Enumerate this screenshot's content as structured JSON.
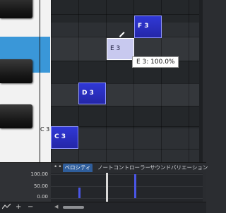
{
  "piano": {
    "labels": {
      "c3": "C 3"
    }
  },
  "notes": [
    {
      "id": "f3",
      "label": "F 3",
      "selected": false
    },
    {
      "id": "e3",
      "label": "E 3",
      "selected": true
    },
    {
      "id": "d3",
      "label": "D 3",
      "selected": false
    },
    {
      "id": "c3",
      "label": "C 3",
      "selected": false
    }
  ],
  "tooltip": {
    "text": "E 3: 100.0%"
  },
  "lower_editor": {
    "menu_dots": "•••",
    "tabs": [
      "ベロシティ",
      "ノートコントローラー",
      "サウンドバリエーション"
    ],
    "active_tab": 0,
    "axis_labels": [
      "100.00",
      "50.00",
      "0.00"
    ],
    "velocity_values": [
      45,
      100
    ]
  },
  "bottom_toolbar": {
    "line_tool_icon": "line-draw-icon",
    "zoom_in_label": "+",
    "zoom_out_label": "−",
    "scroll_left_icon": "◀"
  },
  "colors": {
    "note_fill": "#2a2fc4",
    "note_selected": "#c8c9ef",
    "highlight_key": "#3a97d8",
    "active_tab": "#2f5e9c"
  }
}
